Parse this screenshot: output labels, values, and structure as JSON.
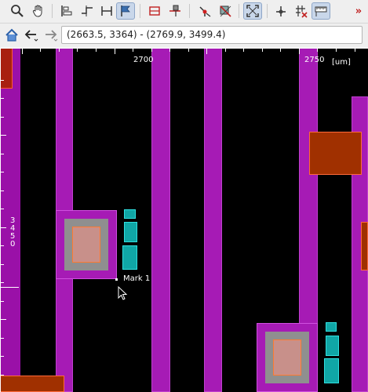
{
  "toolbar": {
    "buttons": [
      {
        "name": "zoom-icon",
        "glyph": "🔍"
      },
      {
        "name": "pan-hand-icon",
        "glyph": "✋"
      },
      {
        "name": "align-left-icon",
        "glyph": "⊏"
      },
      {
        "name": "align-path-icon",
        "glyph": "⌐"
      },
      {
        "name": "ruler-width-icon",
        "glyph": "⊢"
      },
      {
        "name": "flag-icon",
        "glyph": "⚑"
      },
      {
        "name": "h-measure-icon",
        "glyph": "⊞"
      },
      {
        "name": "marker-icon",
        "glyph": "⊤"
      },
      {
        "name": "route-icon",
        "glyph": "⤷"
      },
      {
        "name": "select-area-icon",
        "glyph": "⊠"
      },
      {
        "name": "fit-view-icon",
        "glyph": "⤢"
      },
      {
        "name": "add-anchor-icon",
        "glyph": "⊹"
      },
      {
        "name": "clear-grid-icon",
        "glyph": "⌗"
      },
      {
        "name": "ruler-icon",
        "glyph": "📏"
      },
      {
        "name": "more-chevron-icon",
        "glyph": "»"
      }
    ]
  },
  "navbar": {
    "home_glyph": "⌂",
    "back_glyph": "←",
    "forward_glyph": "→",
    "coordinates": "(2663.5, 3364) - (2769.9, 3499.4)"
  },
  "canvas": {
    "ruler_top_labels": [
      "2700",
      "2750",
      "[um]"
    ],
    "ruler_left_label": [
      "3",
      "4",
      "5",
      "0"
    ],
    "marker_label": "Mark 1"
  },
  "colors": {
    "metal": "#9a10a8",
    "via_fill": "#8f8f8f",
    "cyan": "#10a6a6",
    "orange": "#a03000"
  }
}
